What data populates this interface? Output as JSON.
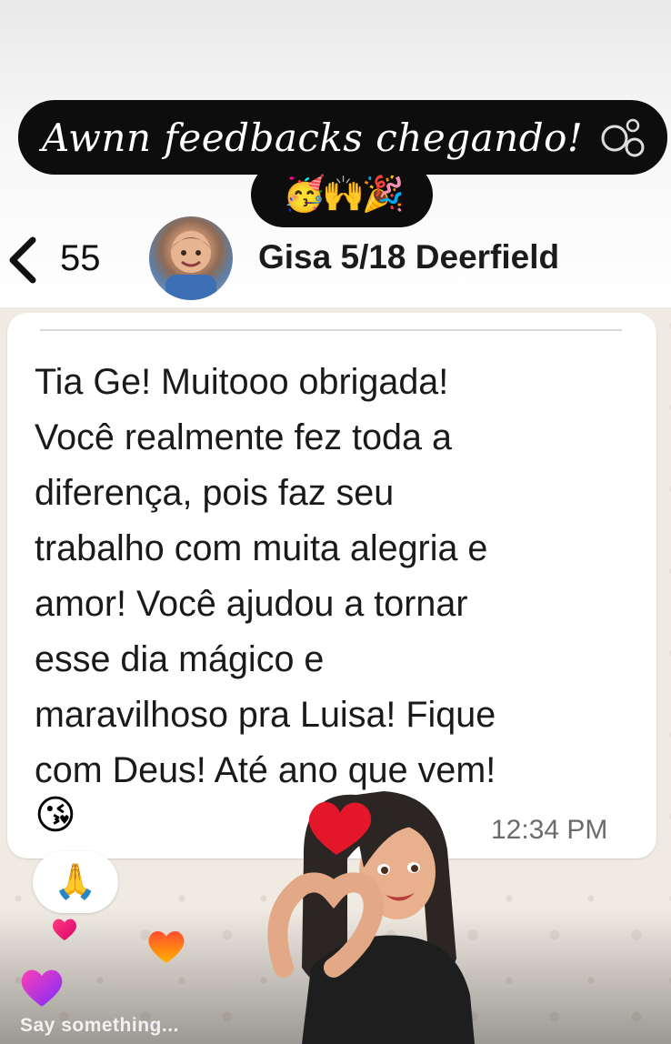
{
  "story": {
    "caption": "Awnn feedbacks chegando!",
    "caption_emojis": "🥳🙌🎉"
  },
  "chat_header": {
    "unread_count": "55",
    "contact_name": "Gisa 5/18 Deerfield"
  },
  "message": {
    "text": "Tia Ge! Muitooo obrigada!\nVocê realmente fez toda a\ndiferença, pois faz seu\ntrabalho com muita alegria e\namor! Você ajudou a tornar\nesse dia mágico e\nmaravilhoso pra Luisa! Fique\ncom Deus! Até ano que vem!",
    "emoji": "😘",
    "time": "12:34 PM",
    "reaction": "🙏"
  },
  "reply_bar": {
    "placeholder": "Say something..."
  },
  "colors": {
    "caption_bg": "#0d0d0d",
    "chat_bg": "#efeae2",
    "bubble_bg": "#ffffff",
    "heart_red": "#e4162a"
  },
  "icons": [
    "back-chevron-icon",
    "bubbles-icon",
    "heart-icon"
  ]
}
